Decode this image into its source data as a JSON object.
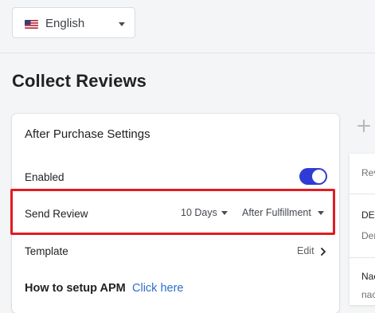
{
  "language_selector": {
    "value": "English",
    "flag_icon": "us-flag-icon"
  },
  "page": {
    "title": "Collect Reviews"
  },
  "settings_card": {
    "title": "After Purchase Settings",
    "enabled": {
      "label": "Enabled",
      "state": true,
      "accent_color": "#2f3cd4"
    },
    "send_review": {
      "label": "Send Review",
      "delay_value": "10 Days",
      "trigger_value": "After Fulfillment",
      "highlight_color": "#e31b23"
    },
    "template": {
      "label": "Template",
      "edit_label": "Edit"
    },
    "setup": {
      "label": "How to setup APM",
      "link_text": "Click here",
      "link_color": "#2c6ecb"
    }
  },
  "right_panel": {
    "header": "Rev",
    "item1_title": "DEI",
    "item1_sub": "Der",
    "item2_title": "Nac",
    "item2_sub": "nac"
  }
}
